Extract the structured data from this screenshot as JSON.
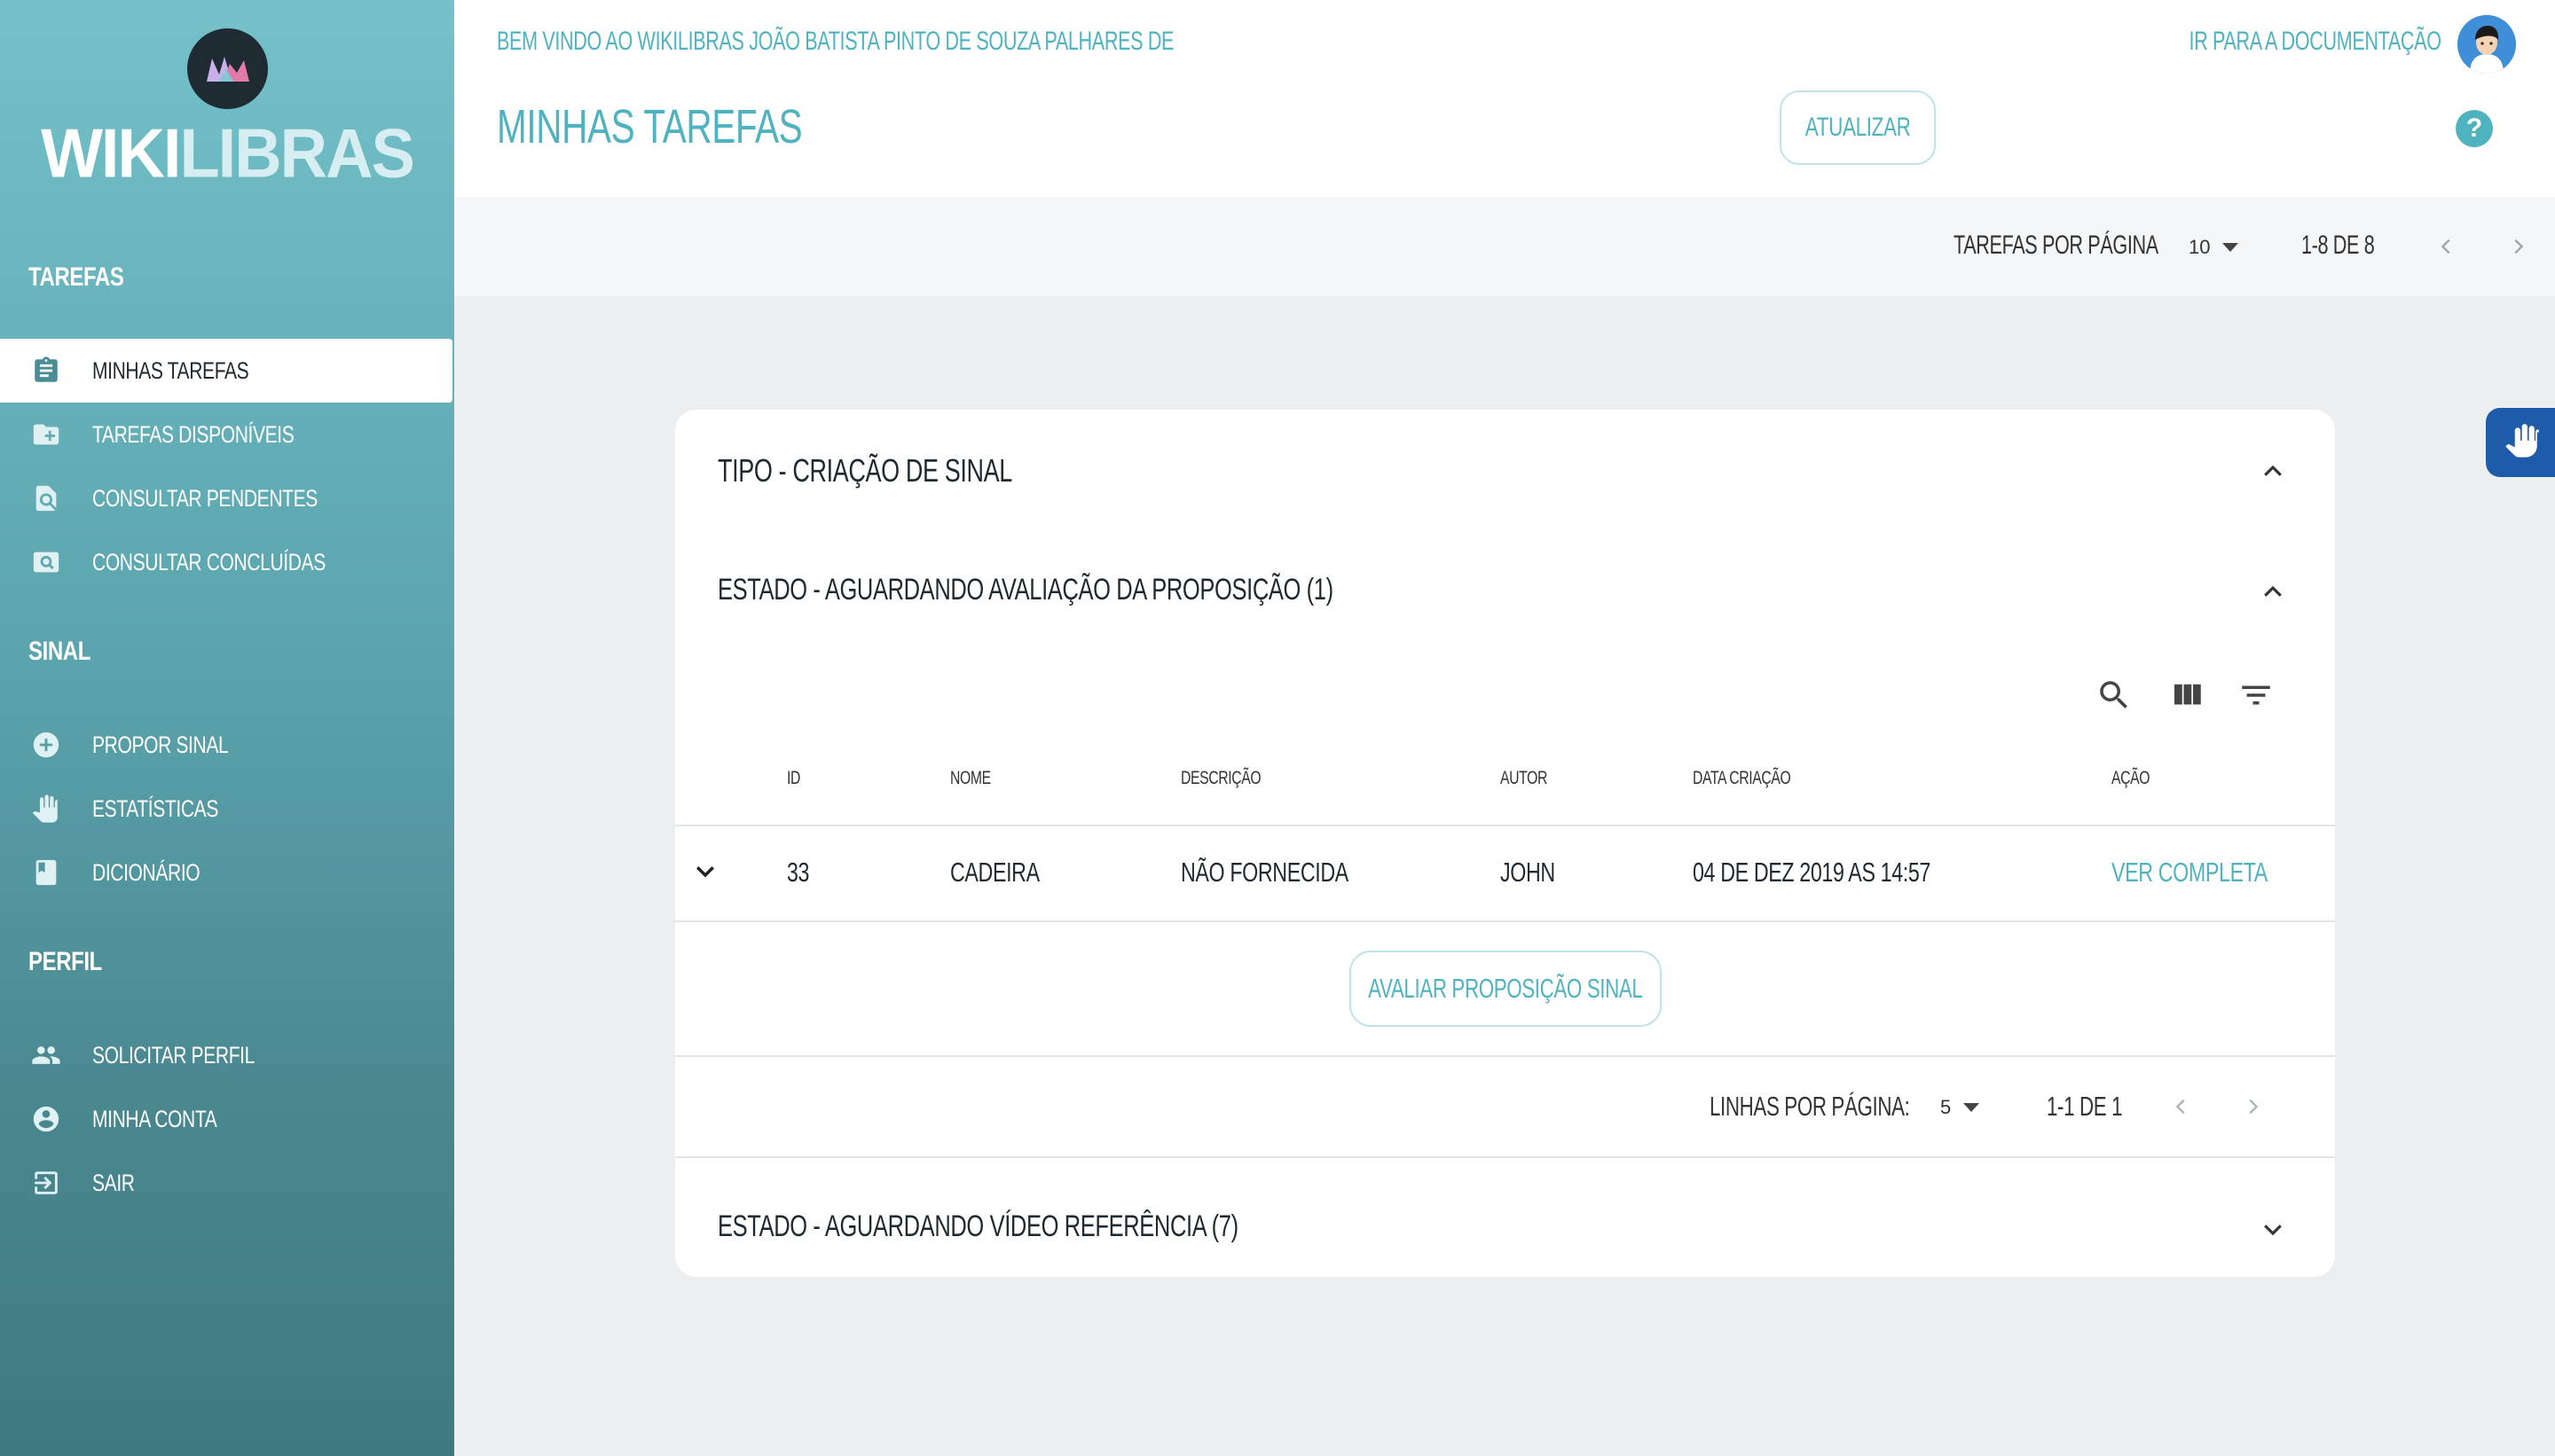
{
  "sidebar": {
    "logo_text_part1": "WIKI",
    "logo_text_part2": "LIBRAS",
    "sections": {
      "tarefas": "TAREFAS",
      "sinal": "SINAL",
      "perfil": "PERFIL"
    },
    "items": {
      "minhas_tarefas": "MINHAS TAREFAS",
      "tarefas_disponiveis": "TAREFAS DISPONÍVEIS",
      "consultar_pendentes": "CONSULTAR PENDENTES",
      "consultar_concluidas": "CONSULTAR CONCLUÍDAS",
      "propor_sinal": "PROPOR SINAL",
      "estatisticas": "ESTATÍSTICAS",
      "dicionario": "DICIONÁRIO",
      "solicitar_perfil": "SOLICITAR PERFIL",
      "minha_conta": "MINHA CONTA",
      "sair": "SAIR"
    },
    "active_item": "minhas_tarefas"
  },
  "header": {
    "welcome": "BEM VINDO AO WIKILIBRAS JOÃO BATISTA PINTO DE SOUZA PALHARES DE",
    "title": "MINHAS TAREFAS",
    "doc_link": "IR PARA A DOCUMENTAÇÃO",
    "refresh_label": "ATUALIZAR",
    "help_glyph": "?"
  },
  "toolbar": {
    "per_page_label": "TAREFAS POR PÁGINA",
    "per_page_value": "10",
    "range": "1-8 DE 8"
  },
  "card": {
    "type_heading": "TIPO - CRIAÇÃO DE SINAL",
    "state1_heading": "ESTADO - AGUARDANDO AVALIAÇÃO DA PROPOSIÇÃO (1)",
    "state2_heading": "ESTADO - AGUARDANDO VÍDEO REFERÊNCIA (7)",
    "columns": {
      "id": "ID",
      "nome": "NOME",
      "descricao": "DESCRIÇÃO",
      "autor": "AUTOR",
      "data": "DATA CRIAÇÃO",
      "acao": "AÇÃO"
    },
    "rows": [
      {
        "id": "33",
        "nome": "CADEIRA",
        "descricao": "NÃO FORNECIDA",
        "autor": "JOHN",
        "data": "04 DE DEZ 2019 AS 14:57",
        "acao": "VER COMPLETA"
      }
    ],
    "eval_button": "AVALIAR PROPOSIÇÃO SINAL",
    "rows_per_page_label": "LINHAS POR PÁGINA:",
    "rows_per_page_value": "5",
    "rows_range": "1-1 DE 1"
  },
  "colors": {
    "accent": "#4fb3bf",
    "sidebar_top": "#74c1ca",
    "sidebar_bottom": "#3f7880",
    "vlibras": "#1e5ba8"
  }
}
